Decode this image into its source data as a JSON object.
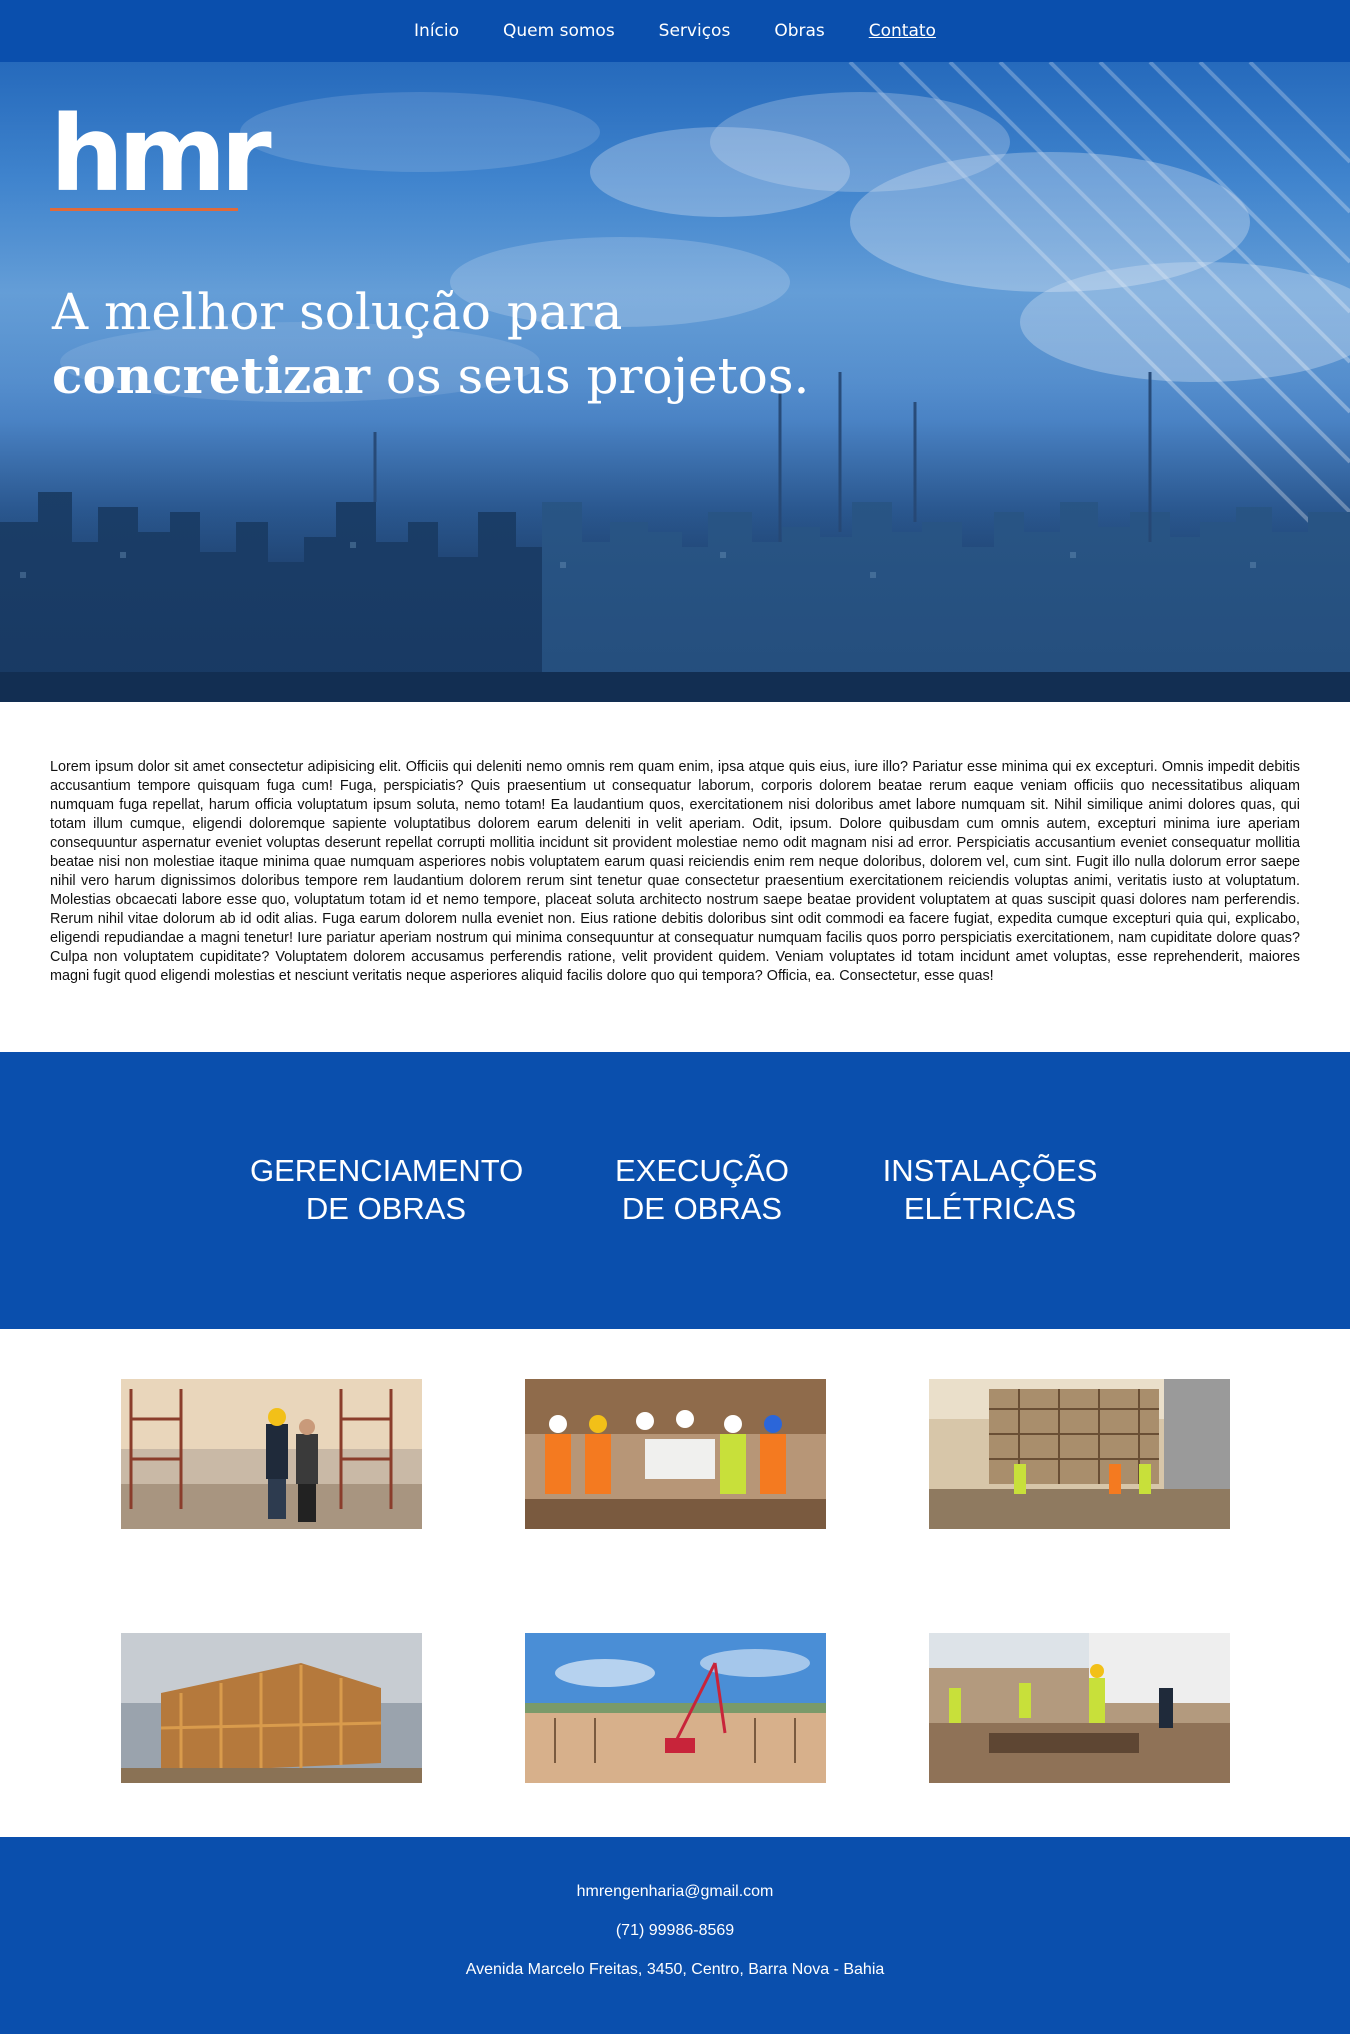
{
  "nav": {
    "items": [
      {
        "label": "Início"
      },
      {
        "label": "Quem somos"
      },
      {
        "label": "Serviços"
      },
      {
        "label": "Obras"
      },
      {
        "label": "Contato"
      }
    ]
  },
  "hero": {
    "logo_text": "hmr",
    "headline_line1": "A melhor solução para",
    "headline_bold": "concretizar",
    "headline_rest": " os seus projetos."
  },
  "about": {
    "text": "Lorem ipsum dolor sit amet consectetur adipisicing elit. Officiis qui deleniti nemo omnis rem quam enim, ipsa atque quis eius, iure illo? Pariatur esse minima qui ex excepturi. Omnis impedit debitis accusantium tempore quisquam fuga cum! Fuga, perspiciatis? Quis praesentium ut consequatur laborum, corporis dolorem beatae rerum eaque veniam officiis quo necessitatibus aliquam numquam fuga repellat, harum officia voluptatum ipsum soluta, nemo totam! Ea laudantium quos, exercitationem nisi doloribus amet labore numquam sit. Nihil similique animi dolores quas, qui totam illum cumque, eligendi doloremque sapiente voluptatibus dolorem earum deleniti in velit aperiam. Odit, ipsum. Dolore quibusdam cum omnis autem, excepturi minima iure aperiam consequuntur aspernatur eveniet voluptas deserunt repellat corrupti mollitia incidunt sit provident molestiae nemo odit magnam nisi ad error. Perspiciatis accusantium eveniet consequatur mollitia beatae nisi non molestiae itaque minima quae numquam asperiores nobis voluptatem earum quasi reiciendis enim rem neque doloribus, dolorem vel, cum sint. Fugit illo nulla dolorum error saepe nihil vero harum dignissimos doloribus tempore rem laudantium dolorem rerum sint tenetur quae consectetur praesentium exercitationem reiciendis voluptas animi, veritatis iusto at voluptatum. Molestias obcaecati labore esse quo, voluptatum totam id et nemo tempore, placeat soluta architecto nostrum saepe beatae provident voluptatem at quas suscipit quasi dolores nam perferendis. Rerum nihil vitae dolorum ab id odit alias. Fuga earum dolorem nulla eveniet non. Eius ratione debitis doloribus sint odit commodi ea facere fugiat, expedita cumque excepturi quia qui, explicabo, eligendi repudiandae a magni tenetur! Iure pariatur aperiam nostrum qui minima consequuntur at consequatur numquam facilis quos porro perspiciatis exercitationem, nam cupiditate dolore quas? Culpa non voluptatem cupiditate? Voluptatem dolorem accusamus perferendis ratione, velit provident quidem. Veniam voluptates id totam incidunt amet voluptas, esse reprehenderit, maiores magni fugit quod eligendi molestias et nesciunt veritatis neque asperiores aliquid facilis dolore quo qui tempora? Officia, ea. Consectetur, esse quas!"
  },
  "services": [
    {
      "line1": "GERENCIAMENTO",
      "line2": "DE OBRAS"
    },
    {
      "line1": "EXECUÇÃO",
      "line2": "DE OBRAS"
    },
    {
      "line1": "INSTALAÇÕES",
      "line2": "ELÉTRICAS"
    }
  ],
  "footer": {
    "email": "hmrengenharia@gmail.com",
    "phone": "(71) 99986-8569",
    "address": "Avenida Marcelo Freitas, 3450, Centro, Barra Nova - Bahia"
  },
  "colors": {
    "brand_blue": "#0a4fad",
    "logo_accent": "#e06a3a"
  }
}
